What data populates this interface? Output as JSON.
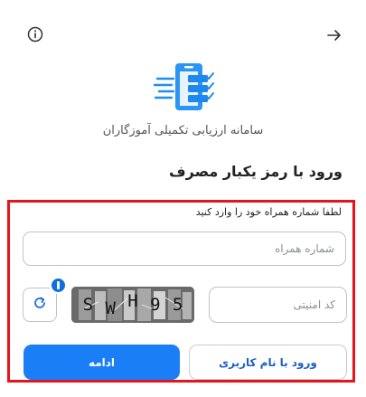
{
  "header": {
    "info_icon": "info-circle-icon",
    "back_icon": "arrow-right-icon"
  },
  "brand": {
    "logo_icon": "checklist-clipboard-icon",
    "app_title": "سامانه ارزیابی تکمیلی آموزگاران"
  },
  "form": {
    "title": "ورود با رمز یکبار مصرف",
    "hint": "لطفا شماره همراه خود را وارد کنید",
    "phone_placeholder": "شماره همراه",
    "captcha_placeholder": "کد امنیتی",
    "captcha_code": [
      "S",
      "W",
      "H",
      "9",
      "5"
    ],
    "refresh_icon": "refresh-icon",
    "continue_label": "ادامه",
    "username_login_label": "ورود با نام کاربری"
  },
  "colors": {
    "primary": "#1a7ff6",
    "highlight_border": "#e8141b",
    "badge": "#0f6fde"
  }
}
